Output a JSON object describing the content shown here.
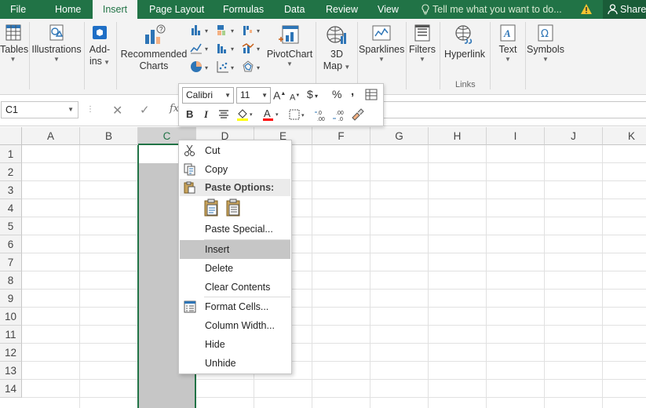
{
  "tabs": [
    {
      "label": "File",
      "active": false
    },
    {
      "label": "Home",
      "active": false
    },
    {
      "label": "Insert",
      "active": true
    },
    {
      "label": "Page Layout",
      "active": false
    },
    {
      "label": "Formulas",
      "active": false
    },
    {
      "label": "Data",
      "active": false
    },
    {
      "label": "Review",
      "active": false
    },
    {
      "label": "View",
      "active": false
    }
  ],
  "tell_me": "Tell me what you want to do...",
  "share": "Share",
  "ribbon": {
    "tables": "Tables",
    "illustrations": "Illustrations",
    "addins_1": "Add-",
    "addins_2": "ins",
    "recommended_charts_1": "Recommended",
    "recommended_charts_2": "Charts",
    "pivotchart": "PivotChart",
    "map_1": "3D",
    "map_2": "Map",
    "sparklines": "Sparklines",
    "filters": "Filters",
    "hyperlink": "Hyperlink",
    "links_group": "Links",
    "text": "Text",
    "symbols": "Symbols"
  },
  "formula_bar": {
    "name_box": "C1",
    "fx": "fx",
    "value": ""
  },
  "columns": [
    "A",
    "B",
    "C",
    "D",
    "E",
    "F",
    "G",
    "H",
    "I",
    "J",
    "K"
  ],
  "rows": [
    "1",
    "2",
    "3",
    "4",
    "5",
    "6",
    "7",
    "8",
    "9",
    "10",
    "11",
    "12",
    "13",
    "14"
  ],
  "selected_column": "C",
  "mini_toolbar": {
    "font": "Calibri",
    "size": "11",
    "bold": "B",
    "italic": "I",
    "percent": "%",
    "comma": ",",
    "currency": "$"
  },
  "context_menu": {
    "cut": "Cut",
    "copy": "Copy",
    "paste_options": "Paste Options:",
    "paste_special": "Paste Special...",
    "insert": "Insert",
    "delete": "Delete",
    "clear_contents": "Clear Contents",
    "format_cells": "Format Cells...",
    "column_width": "Column Width...",
    "hide": "Hide",
    "unhide": "Unhide"
  },
  "colors": {
    "accent": "#217346",
    "ribbon_bg": "#f3f3f3",
    "selection": "#c6c6c6"
  }
}
